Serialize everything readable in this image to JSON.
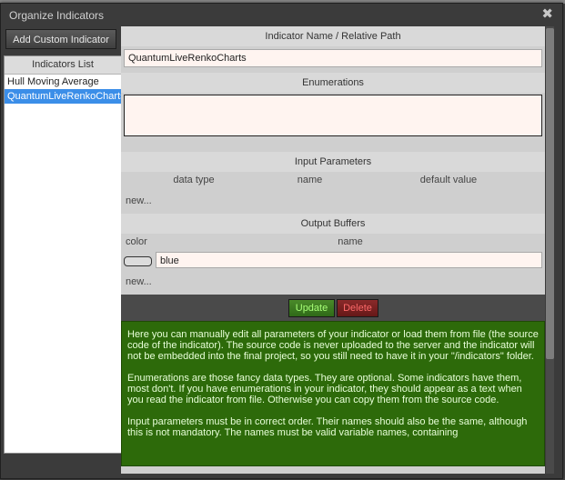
{
  "window": {
    "title": "Organize Indicators",
    "close_glyph": "✖"
  },
  "left": {
    "add_button": "Add Custom Indicator",
    "list_header": "Indicators List",
    "items": [
      "Hull Moving Average",
      "QuantumLiveRenkoCharts"
    ],
    "selected_index": 1
  },
  "name_section": {
    "header": "Indicator Name / Relative Path",
    "value": "QuantumLiveRenkoCharts"
  },
  "enum_section": {
    "header": "Enumerations",
    "value": ""
  },
  "input_section": {
    "header": "Input Parameters",
    "columns": [
      "data type",
      "name",
      "default value"
    ],
    "new_label": "new..."
  },
  "output_section": {
    "header": "Output Buffers",
    "columns": [
      "color",
      "name"
    ],
    "buffers": [
      {
        "name": "blue"
      }
    ],
    "new_label": "new..."
  },
  "buttons": {
    "update": "Update",
    "delete": "Delete"
  },
  "help_paragraphs": [
    "Here you can manually edit all parameters of your indicator or load them from file (the source code of the indicator). The source code is never uploaded to the server and the indicator will not be embedded into the final project, so you still need to have it in your \"/indicators\" folder.",
    "Enumerations are those fancy data types. They are optional. Some indicators have them, most don't. If you have enumerations in your indicator, they should appear as a text when you read the indicator from file. Otherwise you can copy them from the source code.",
    "Input parameters must be in correct order. Their names should also be the same, although this is not mandatory. The names must be valid variable names, containing"
  ],
  "colors": {
    "window_bg": "#3b3b3b",
    "panel_bg": "#cfcfcf",
    "field_bg": "#fff4f0",
    "selection": "#3b8ee8",
    "help_bg": "#2d6a0a",
    "update_text": "#a8ff78",
    "delete_text": "#ff6a6a"
  }
}
